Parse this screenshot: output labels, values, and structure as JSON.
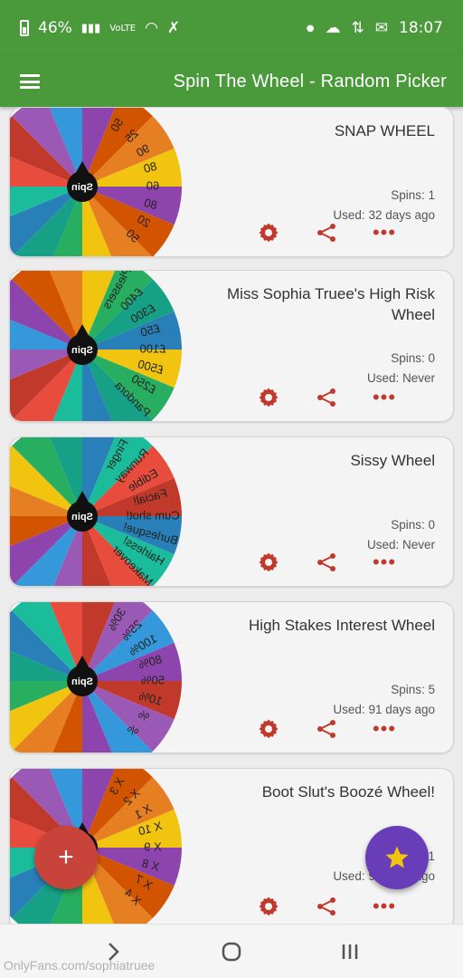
{
  "status_bar": {
    "time": "18:07",
    "battery": "46%",
    "network": "VoLTE"
  },
  "app_bar": {
    "title": "Spin The Wheel - Random Picker"
  },
  "wheels": [
    {
      "title": "SNAP WHEEL",
      "spins": "Spins: 1",
      "used": "Used: 32 days ago",
      "spin_label": "Spin",
      "segments": [
        "50",
        "25",
        "90",
        "80",
        "60",
        "80",
        "20",
        "50"
      ]
    },
    {
      "title": "Miss Sophia Truee's High Risk Wheel",
      "spins": "Spins: 0",
      "used": "Used: Never",
      "spin_label": "Spin",
      "segments": [
        "Pleasers",
        "£400",
        "£300",
        "£50",
        "£100",
        "£500",
        "£250",
        "Pandora"
      ]
    },
    {
      "title": "Sissy Wheel",
      "spins": "Spins: 0",
      "used": "Used: Never",
      "spin_label": "Spin",
      "segments": [
        "Finger",
        "Runway",
        "Edible",
        "Facial!",
        "Cum shot!",
        "Burlesque!",
        "Hairless!",
        "Makeover"
      ]
    },
    {
      "title": "High Stakes Interest Wheel",
      "spins": "Spins: 5",
      "used": "Used: 91 days ago",
      "spin_label": "Spin",
      "segments": [
        "30%",
        "25%",
        "100%",
        "80%",
        "50%",
        "10%",
        "%",
        "%"
      ]
    },
    {
      "title": "Boot Slut's Boozé Wheel!",
      "spins": "Spins: 1",
      "used": "Used: 91 days ago",
      "spin_label": "Spin",
      "segments": [
        "X 3",
        "X 2",
        "X 1",
        "X 10",
        "X 9",
        "X 8",
        "X 7",
        "X 4"
      ]
    }
  ],
  "colors": {
    "primary": "#4a9a3c",
    "accent_red": "#c8443b",
    "accent_purple": "#6a3db8",
    "icon_red": "#c0392b",
    "star": "#f1c40f"
  },
  "icons": {
    "settings": "gear-icon",
    "share": "share-icon",
    "more": "more-dots-icon",
    "add": "plus-icon",
    "star": "star-icon",
    "menu": "hamburger-icon"
  },
  "fab": {
    "add_label": "+"
  },
  "watermark": "OnlyFans.com/sophiatruee"
}
